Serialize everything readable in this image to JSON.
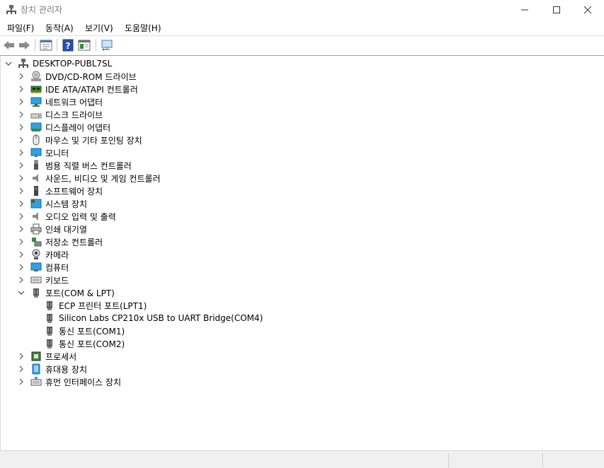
{
  "window": {
    "title": "장치 관리자",
    "app_icon": "device-manager-icon"
  },
  "menu": {
    "file": "파일(F)",
    "action": "동작(A)",
    "view": "보기(V)",
    "help": "도움말(H)"
  },
  "toolbar": {
    "icons": [
      "back-arrow-icon",
      "forward-arrow-icon",
      "properties-icon",
      "help-icon",
      "update-driver-icon",
      "scan-hardware-icon"
    ]
  },
  "tree": {
    "root": "DESKTOP-PUBL7SL",
    "categories": [
      "DVD/CD-ROM 드라이브",
      "IDE ATA/ATAPI 컨트롤러",
      "네트워크 어댑터",
      "디스크 드라이브",
      "디스플레이 어댑터",
      "마우스 및 기타 포인팅 장치",
      "모니터",
      "범용 직렬 버스 컨트롤러",
      "사운드, 비디오 및 게임 컨트롤러",
      "소프트웨어 장치",
      "시스템 장치",
      "오디오 입력 및 출력",
      "인쇄 대기열",
      "저장소 컨트롤러",
      "카메라",
      "컴퓨터",
      "키보드",
      "포트(COM & LPT)"
    ],
    "ports_children": [
      "ECP 프린터 포트(LPT1)",
      "Silicon Labs CP210x USB to UART Bridge(COM4)",
      "통신 포트(COM1)",
      "통신 포트(COM2)"
    ],
    "categories_after": [
      "프로세서",
      "휴대용 장치",
      "휴먼 인터페이스 장치"
    ]
  }
}
